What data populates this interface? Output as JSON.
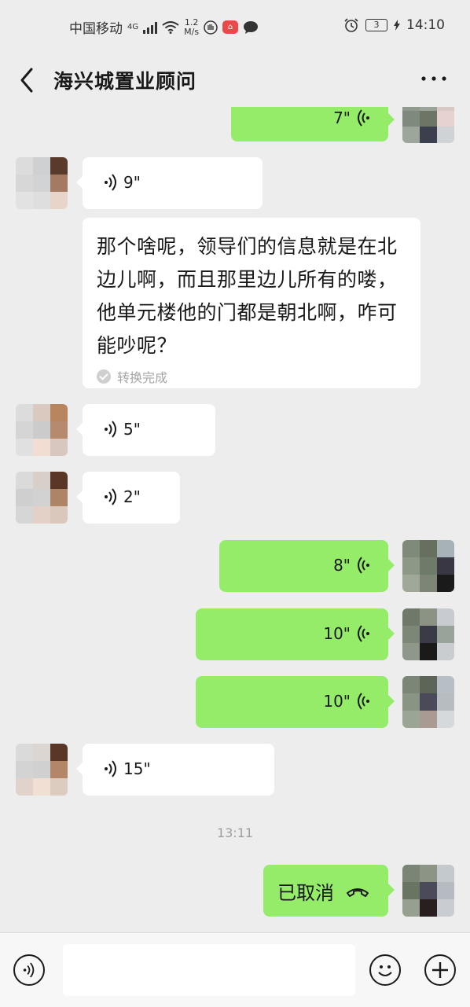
{
  "status_bar": {
    "carrier": "中国移动",
    "network": "4G",
    "speed_value": "1.2",
    "speed_unit": "M/s",
    "battery": "3",
    "time": "14:10"
  },
  "header": {
    "title": "海兴城置业顾问"
  },
  "messages": {
    "m0": {
      "duration": "7\""
    },
    "m1": {
      "duration": "9\""
    },
    "transcript": {
      "text": "那个啥呢，领导们的信息就是在北边儿啊，而且那里边儿所有的喽，他单元楼他的门都是朝北啊，咋可能吵呢？",
      "status": "转换完成"
    },
    "m2": {
      "duration": "5\""
    },
    "m3": {
      "duration": "2\""
    },
    "m4": {
      "duration": "8\""
    },
    "m5": {
      "duration": "10\""
    },
    "m6": {
      "duration": "10\""
    },
    "m7": {
      "duration": "15\""
    },
    "timestamp": "13:11",
    "m8": {
      "text": "已取消"
    }
  },
  "colors": {
    "background": "#ededed",
    "bubble_out": "#95ec69",
    "bubble_in": "#ffffff"
  },
  "icons": {
    "back": "chevron-left-icon",
    "more": "more-dots-icon",
    "voice": "voice-wave-icon",
    "hangup": "phone-hangup-icon",
    "emoji": "emoji-icon",
    "plus": "plus-icon"
  }
}
